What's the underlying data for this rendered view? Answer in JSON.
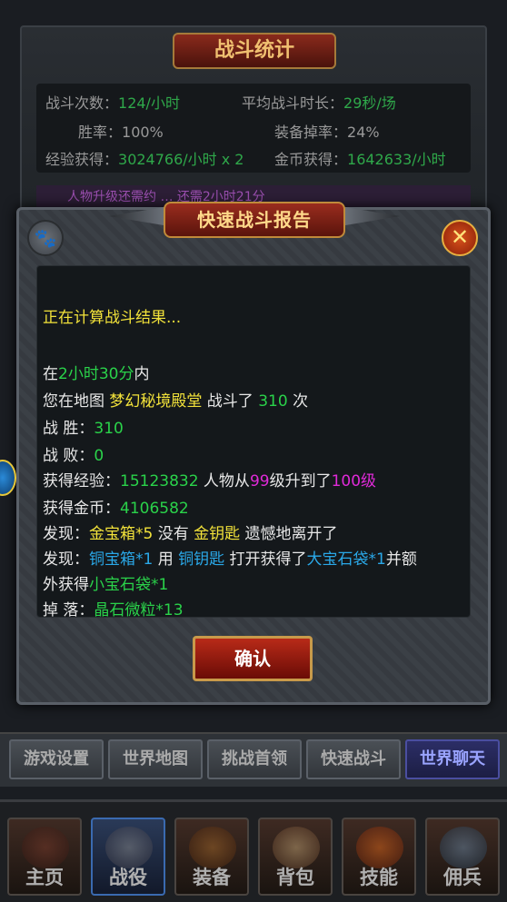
{
  "stats": {
    "title": "战斗统计",
    "battles_label": "战斗次数：",
    "battles_value": "124/小时",
    "avg_time_label": "平均战斗时长：",
    "avg_time_value": "29秒/场",
    "win_rate_label": "胜率：",
    "win_rate_value": "100%",
    "drop_rate_label": "装备掉率：",
    "drop_rate_value": "24%",
    "exp_label": "经验获得：",
    "exp_value": "3024766/小时 x 2",
    "gold_label": "金币获得：",
    "gold_value": "1642633/小时",
    "strip_text": "人物升级还需约 … 还需2小时21分"
  },
  "modal": {
    "title": "快速战斗报告",
    "paw_icon": "paw-icon",
    "close_icon": "close-icon",
    "computing": "正在计算战斗结果...",
    "in_prefix": "在",
    "duration": "2小时30分",
    "in_suffix": "内",
    "map_prefix": "您在地图 ",
    "map_name": "梦幻秘境殿堂",
    "map_mid": " 战斗了 ",
    "battle_count": "310",
    "map_suffix": " 次",
    "win_label": "战      胜：",
    "win_value": "310",
    "lose_label": "战      败：",
    "lose_value": "0",
    "exp_label": "获得经验：",
    "exp_value": "15123832",
    "exp_mid": "  人物从",
    "level_from": "99",
    "level_mid": "级升到了",
    "level_to": "100级",
    "gold_label": "获得金币：",
    "gold_value": "4106582",
    "find1_label": "发现：",
    "find1_item": "金宝箱*5",
    "find1_mid": " 没有 ",
    "find1_key": "金钥匙",
    "find1_suffix": " 遗憾地离开了",
    "find2_label": "发现：",
    "find2_item": "铜宝箱*1",
    "find2_mid": " 用 ",
    "find2_key": "铜钥匙",
    "find2_mid2": " 打开获得了",
    "find2_reward": "大宝石袋*1",
    "find2_suffix": "并额",
    "extra_prefix": "外获得",
    "extra_item": "小宝石袋*1",
    "drop_label": "掉      落：",
    "drop_value": "晶石微粒*13",
    "confirm": "确认"
  },
  "functions": [
    "游戏设置",
    "世界地图",
    "挑战首领",
    "快速战斗",
    "世界聊天"
  ],
  "tabs": [
    "主页",
    "战役",
    "装备",
    "背包",
    "技能",
    "佣兵"
  ],
  "colors": {
    "green": "#2ad24a",
    "yellow": "#f2e23a",
    "magenta": "#e02ad8",
    "blue": "#2aa8e8"
  }
}
